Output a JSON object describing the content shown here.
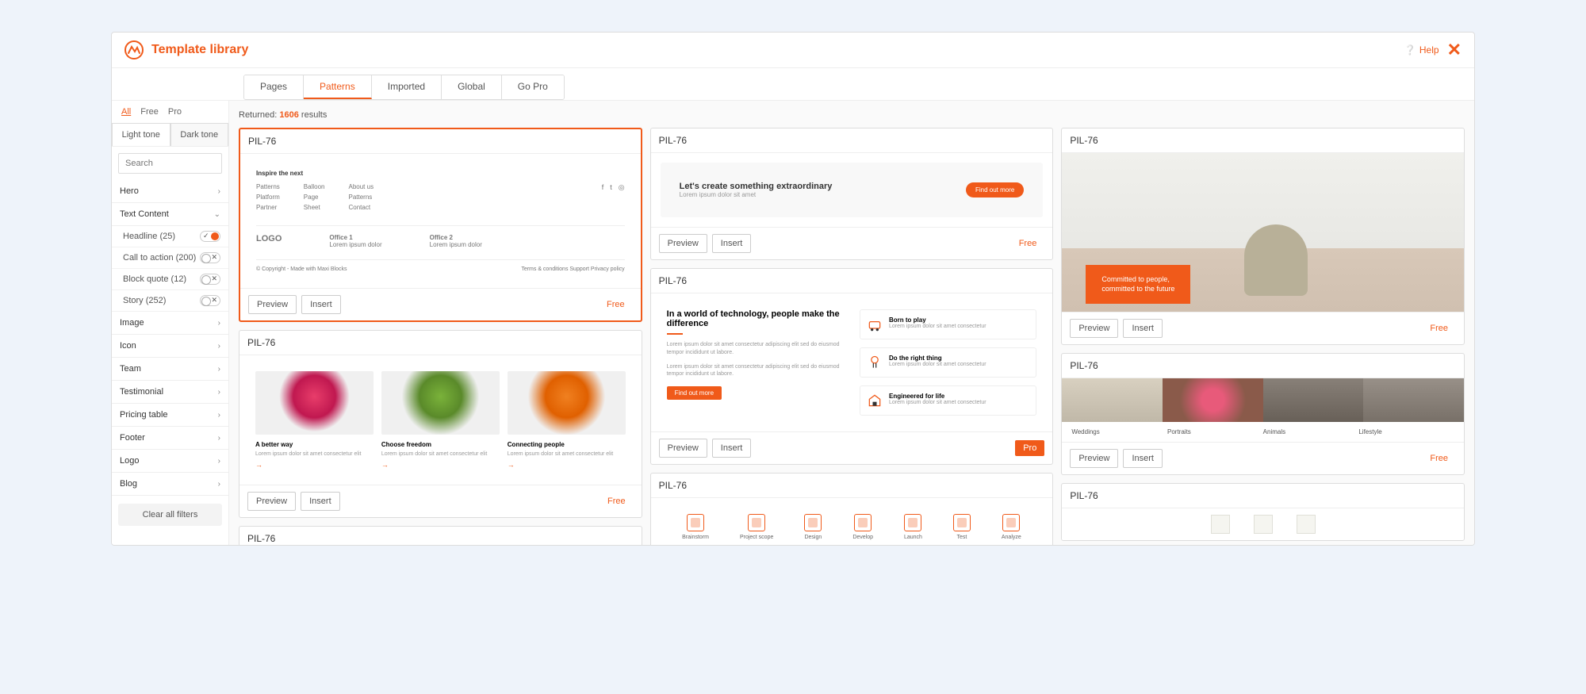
{
  "header": {
    "title": "Template library",
    "help": "Help"
  },
  "tabs": {
    "main": [
      "Pages",
      "Patterns",
      "Imported",
      "Global",
      "Go Pro"
    ],
    "active": "Patterns"
  },
  "sidebar": {
    "pills": [
      "All",
      "Free",
      "Pro"
    ],
    "pill_active": "All",
    "tones": {
      "light": "Light tone",
      "dark": "Dark tone"
    },
    "search_placeholder": "Search",
    "categories": [
      {
        "label": "Hero"
      },
      {
        "label": "Text Content",
        "expanded": true,
        "sub": [
          {
            "label": "Headline (25)",
            "on": true
          },
          {
            "label": "Call to action (200)",
            "on": false
          },
          {
            "label": "Block quote (12)",
            "on": false
          },
          {
            "label": "Story (252)",
            "on": false
          }
        ]
      },
      {
        "label": "Image"
      },
      {
        "label": "Icon"
      },
      {
        "label": "Team"
      },
      {
        "label": "Testimonial"
      },
      {
        "label": "Pricing table"
      },
      {
        "label": "Footer"
      },
      {
        "label": "Logo"
      },
      {
        "label": "Blog"
      }
    ],
    "clear": "Clear all filters"
  },
  "results": {
    "prefix": "Returned:",
    "count": "1606",
    "suffix": "results"
  },
  "actions": {
    "preview": "Preview",
    "insert": "Insert",
    "free": "Free",
    "pro": "Pro"
  },
  "cards": {
    "name": "PIL-76",
    "footer": {
      "h": "Inspire the next",
      "c1": [
        "Patterns",
        "Platform",
        "Partner"
      ],
      "c2": [
        "Balloon",
        "Page",
        "Sheet"
      ],
      "c3": [
        "About us",
        "Patterns",
        "Contact"
      ],
      "logo": "LOGO",
      "off1": "Office 1",
      "off2": "Office 2",
      "copyright": "© Copyright - Made with Maxi Blocks",
      "links": "Terms & conditions   Support   Privacy policy"
    },
    "cta": {
      "t1": "Let's create something extraordinary",
      "t2": "Lorem ipsum dolor sit amet"
    },
    "desk": {
      "l1": "Committed to people,",
      "l2": "committed to the future"
    },
    "tech": {
      "h": "In a world of technology, people make the difference",
      "txt": "Lorem ipsum dolor sit amet consectetur adipiscing elit sed do eiusmod tempor incididunt ut labore.",
      "more": "Find out more",
      "items": [
        {
          "t": "Born to play",
          "d": "Lorem ipsum dolor sit amet consectetur"
        },
        {
          "t": "Do the right thing",
          "d": "Lorem ipsum dolor sit amet consectetur"
        },
        {
          "t": "Engineered for life",
          "d": "Lorem ipsum dolor sit amet consectetur"
        }
      ]
    },
    "flowers": {
      "items": [
        {
          "t": "A better way",
          "d": "Lorem ipsum dolor sit amet consectetur elit"
        },
        {
          "t": "Choose freedom",
          "d": "Lorem ipsum dolor sit amet consectetur elit"
        },
        {
          "t": "Connecting people",
          "d": "Lorem ipsum dolor sit amet consectetur elit"
        }
      ]
    },
    "icons": [
      "Brainstorm",
      "Project scope",
      "Design",
      "Develop",
      "Launch",
      "Test",
      "Analyze"
    ],
    "photos": [
      "Weddings",
      "Portraits",
      "Animals",
      "Lifestyle"
    ]
  }
}
